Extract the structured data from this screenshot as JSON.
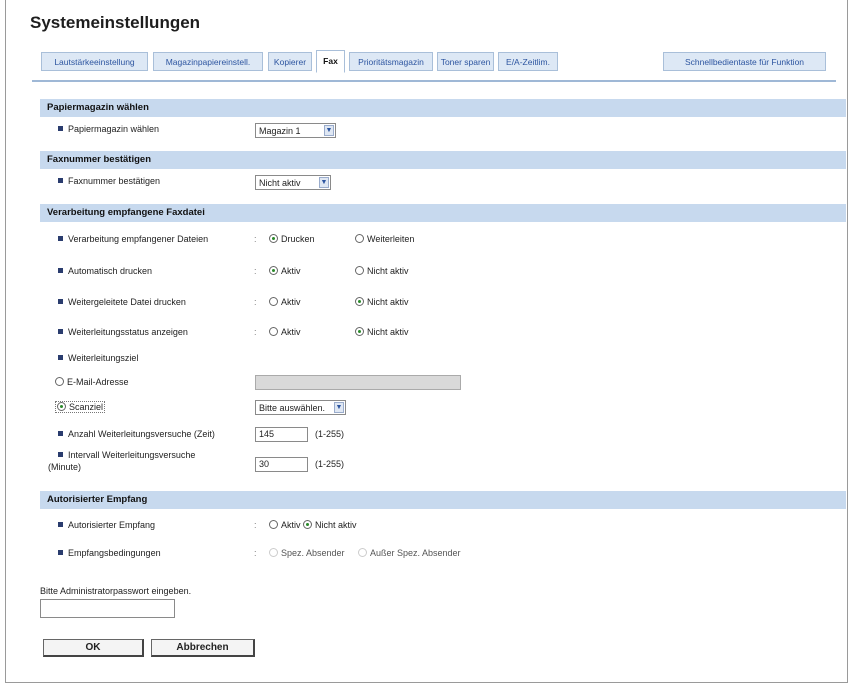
{
  "page": {
    "title": "Systemeinstellungen"
  },
  "tabs": [
    {
      "label": "Lautstärkeeinstellung"
    },
    {
      "label": "Magazinpapiereinstell."
    },
    {
      "label": "Kopierer"
    },
    {
      "label": "Fax",
      "active": true
    },
    {
      "label": "Prioritätsmagazin"
    },
    {
      "label": "Toner sparen"
    },
    {
      "label": "E/A-Zeitlim."
    },
    {
      "label": "Schnellbedientaste für Funktion"
    }
  ],
  "sections": {
    "paper": {
      "header": "Papiermagazin wählen",
      "tray_label": "Papiermagazin wählen",
      "tray_value": "Magazin 1"
    },
    "faxnum": {
      "header": "Faxnummer bestätigen",
      "confirm_label": "Faxnummer bestätigen",
      "confirm_value": "Nicht aktiv"
    },
    "processing": {
      "header": "Verarbeitung empfangene Faxdatei",
      "files_label": "Verarbeitung empfangener Dateien",
      "files_opt1": "Drucken",
      "files_opt2": "Weiterleiten",
      "autoprint_label": "Automatisch drucken",
      "autoprint_opt1": "Aktiv",
      "autoprint_opt2": "Nicht aktiv",
      "fwdprint_label": "Weitergeleitete Datei drucken",
      "fwdprint_opt1": "Aktiv",
      "fwdprint_opt2": "Nicht aktiv",
      "fwdstatus_label": "Weiterleitungsstatus anzeigen",
      "fwdstatus_opt1": "Aktiv",
      "fwdstatus_opt2": "Nicht aktiv",
      "dest_label": "Weiterleitungsziel",
      "email_label": "E-Mail-Adresse",
      "email_value": "",
      "scan_label": "Scanziel",
      "scan_value": "Bitte auswählen.",
      "attempts_label": "Anzahl Weiterleitungsversuche (Zeit)",
      "attempts_value": "145",
      "attempts_hint": "(1-255)",
      "interval_label_1": "Intervall Weiterleitungsversuche",
      "interval_label_2": "(Minute)",
      "interval_value": "30",
      "interval_hint": "(1-255)"
    },
    "authorized": {
      "header": "Autorisierter Empfang",
      "auth_label": "Autorisierter Empfang",
      "auth_opt1": "Aktiv",
      "auth_opt2": "Nicht aktiv",
      "cond_label": "Empfangsbedingungen",
      "cond_opt1": "Spez. Absender",
      "cond_opt2": "Außer Spez. Absender"
    }
  },
  "admin": {
    "prompt": "Bitte Administratorpasswort eingeben.",
    "password_value": ""
  },
  "buttons": {
    "ok": "OK",
    "cancel": "Abbrechen"
  },
  "colons": {
    "sep": ":"
  },
  "icons": {
    "dropdown_arrow": "▼"
  }
}
